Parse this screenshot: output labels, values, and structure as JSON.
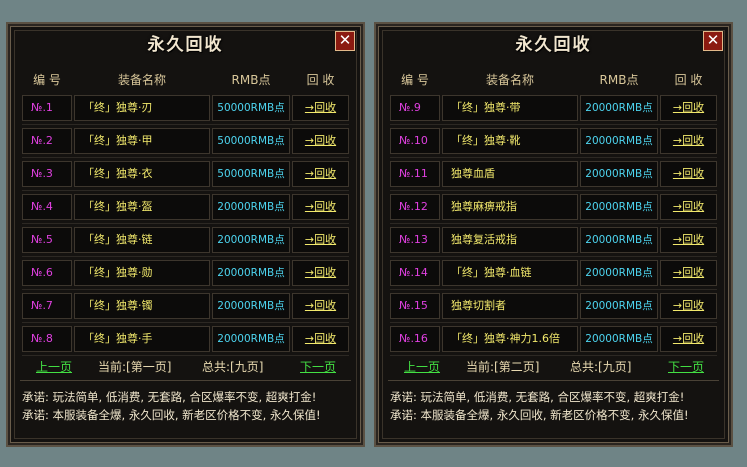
{
  "panels": [
    {
      "title": "永久回收",
      "close_label": "✕",
      "headers": {
        "no": "编 号",
        "name": "装备名称",
        "price": "RMB点",
        "action": "回 收"
      },
      "rows": [
        {
          "no": "№.1",
          "name": "「终」独尊·刃",
          "price": "50000RMB点",
          "action": "→回收"
        },
        {
          "no": "№.2",
          "name": "「终」独尊·甲",
          "price": "50000RMB点",
          "action": "→回收"
        },
        {
          "no": "№.3",
          "name": "「终」独尊·衣",
          "price": "50000RMB点",
          "action": "→回收"
        },
        {
          "no": "№.4",
          "name": "「终」独尊·盔",
          "price": "20000RMB点",
          "action": "→回收"
        },
        {
          "no": "№.5",
          "name": "「终」独尊·链",
          "price": "20000RMB点",
          "action": "→回收"
        },
        {
          "no": "№.6",
          "name": "「终」独尊·勋",
          "price": "20000RMB点",
          "action": "→回收"
        },
        {
          "no": "№.7",
          "name": "「终」独尊·镯",
          "price": "20000RMB点",
          "action": "→回收"
        },
        {
          "no": "№.8",
          "name": "「终」独尊·手",
          "price": "20000RMB点",
          "action": "→回收"
        }
      ],
      "pager": {
        "prev": "上一页",
        "current": "当前:[第一页]",
        "total": "总共:[九页]",
        "next": "下一页"
      },
      "notes": [
        "承诺: 玩法简单, 低消费, 无套路, 合区爆率不变, 超爽打金!",
        "承诺: 本服装备全爆, 永久回收, 新老区价格不变, 永久保值!"
      ]
    },
    {
      "title": "永久回收",
      "close_label": "✕",
      "headers": {
        "no": "编 号",
        "name": "装备名称",
        "price": "RMB点",
        "action": "回 收"
      },
      "rows": [
        {
          "no": "№.9",
          "name": "「终」独尊·带",
          "price": "20000RMB点",
          "action": "→回收"
        },
        {
          "no": "№.10",
          "name": "「终」独尊·靴",
          "price": "20000RMB点",
          "action": "→回收"
        },
        {
          "no": "№.11",
          "name": "独尊血盾",
          "price": "20000RMB点",
          "action": "→回收"
        },
        {
          "no": "№.12",
          "name": "独尊麻痹戒指",
          "price": "20000RMB点",
          "action": "→回收"
        },
        {
          "no": "№.13",
          "name": "独尊复活戒指",
          "price": "20000RMB点",
          "action": "→回收"
        },
        {
          "no": "№.14",
          "name": "「终」独尊·血链",
          "price": "20000RMB点",
          "action": "→回收"
        },
        {
          "no": "№.15",
          "name": "独尊切割者",
          "price": "20000RMB点",
          "action": "→回收"
        },
        {
          "no": "№.16",
          "name": "「终」独尊·神力1.6倍",
          "price": "20000RMB点",
          "action": "→回收"
        }
      ],
      "pager": {
        "prev": "上一页",
        "current": "当前:[第二页]",
        "total": "总共:[九页]",
        "next": "下一页"
      },
      "notes": [
        "承诺: 玩法简单, 低消费, 无套路, 合区爆率不变, 超爽打金!",
        "承诺: 本服装备全爆, 永久回收, 新老区价格不变, 永久保值!"
      ]
    }
  ]
}
